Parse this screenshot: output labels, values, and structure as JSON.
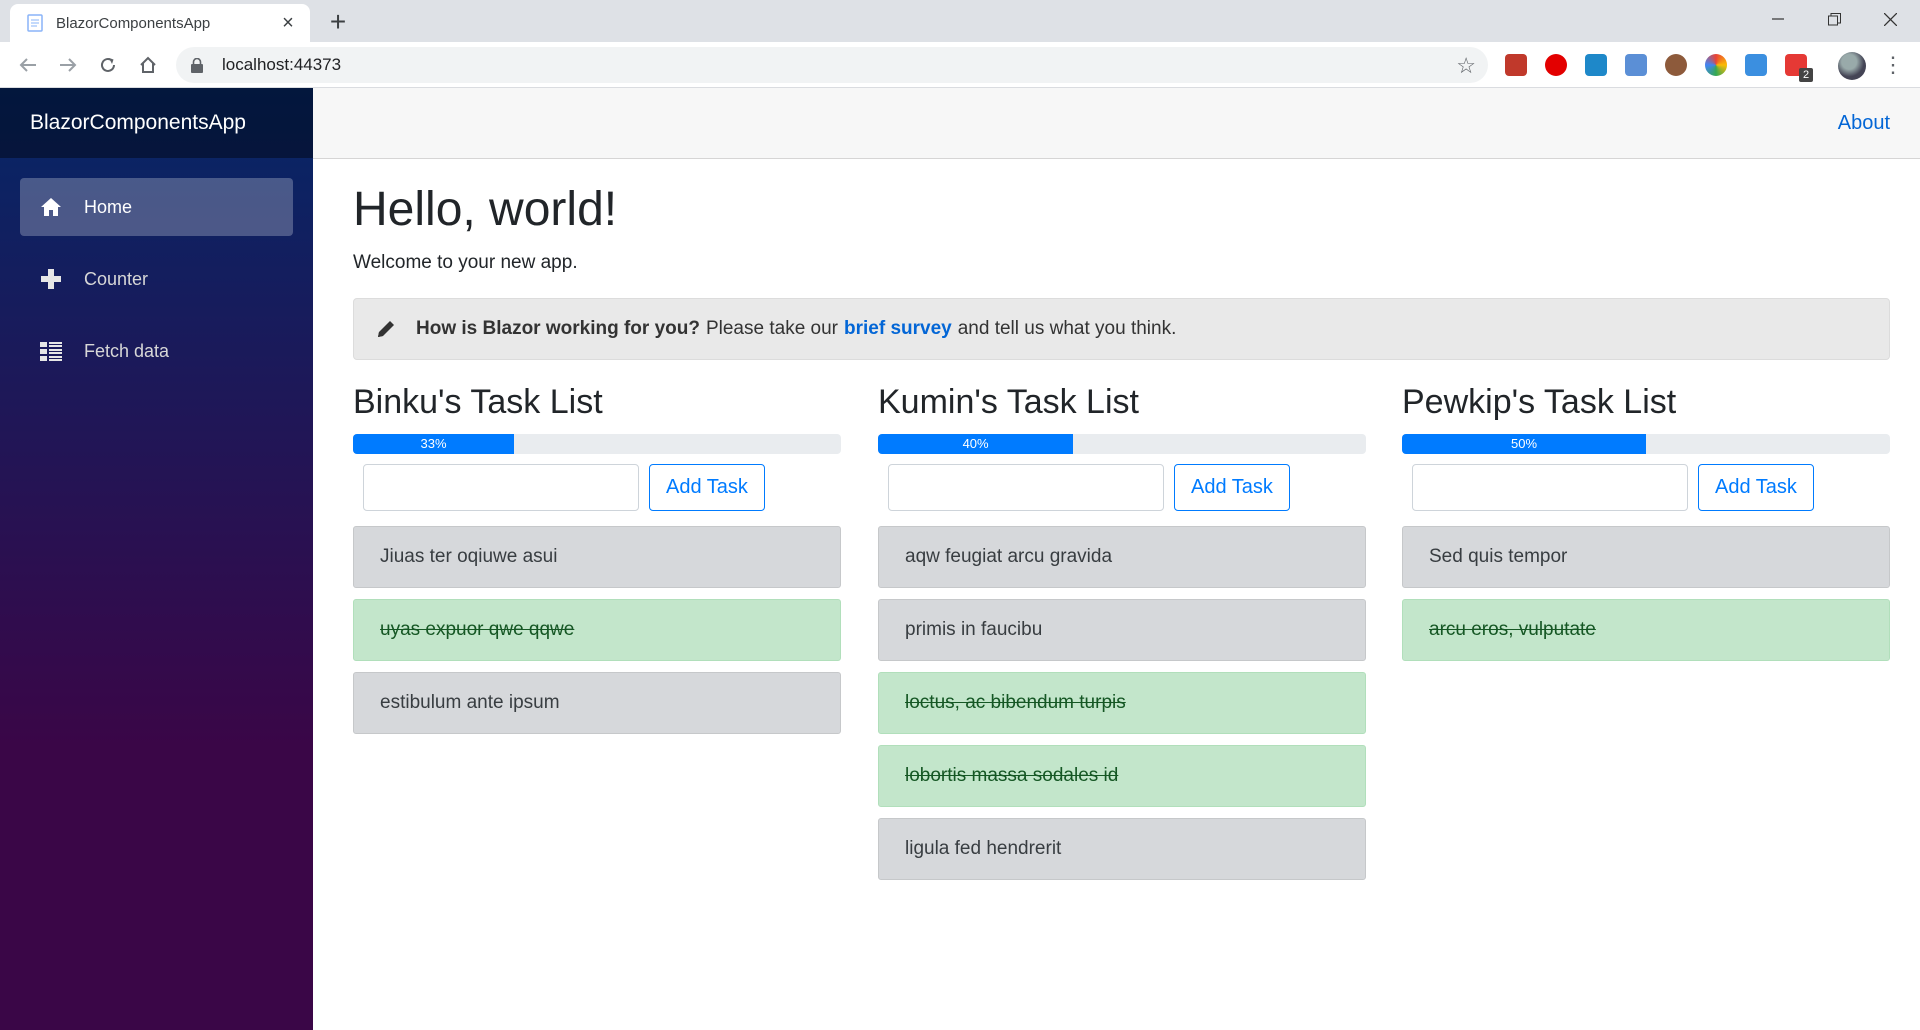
{
  "browser": {
    "tab_title": "BlazorComponentsApp",
    "url": "localhost:44373",
    "extension_badge": "2"
  },
  "app": {
    "brand": "BlazorComponentsApp",
    "about": "About",
    "nav": [
      {
        "label": "Home",
        "icon": "home-icon",
        "active": true
      },
      {
        "label": "Counter",
        "icon": "plus-icon",
        "active": false
      },
      {
        "label": "Fetch data",
        "icon": "list-icon",
        "active": false
      }
    ]
  },
  "page": {
    "title": "Hello, world!",
    "welcome": "Welcome to your new app.",
    "survey": {
      "question": "How is Blazor working for you?",
      "pre_link": "Please take our",
      "link": "brief survey",
      "post_link": "and tell us what you think."
    }
  },
  "task_lists": [
    {
      "title": "Binku's Task List",
      "progress": 33,
      "progress_label": "33%",
      "add_label": "Add Task",
      "tasks": [
        {
          "text": "Jiuas ter oqiuwe asui",
          "done": false
        },
        {
          "text": "uyas expuor qwe qqwe",
          "done": true
        },
        {
          "text": "estibulum ante ipsum",
          "done": false
        }
      ]
    },
    {
      "title": "Kumin's Task List",
      "progress": 40,
      "progress_label": "40%",
      "add_label": "Add Task",
      "tasks": [
        {
          "text": "aqw feugiat arcu gravida",
          "done": false
        },
        {
          "text": "primis in faucibu",
          "done": false
        },
        {
          "text": "loctus, ac bibendum turpis",
          "done": true
        },
        {
          "text": "lobortis massa sodales id",
          "done": true
        },
        {
          "text": "ligula fed hendrerit",
          "done": false
        }
      ]
    },
    {
      "title": "Pewkip's Task List",
      "progress": 50,
      "progress_label": "50%",
      "add_label": "Add Task",
      "tasks": [
        {
          "text": "Sed quis tempor",
          "done": false
        },
        {
          "text": "arcu eros, vulputate",
          "done": true
        }
      ]
    }
  ]
}
